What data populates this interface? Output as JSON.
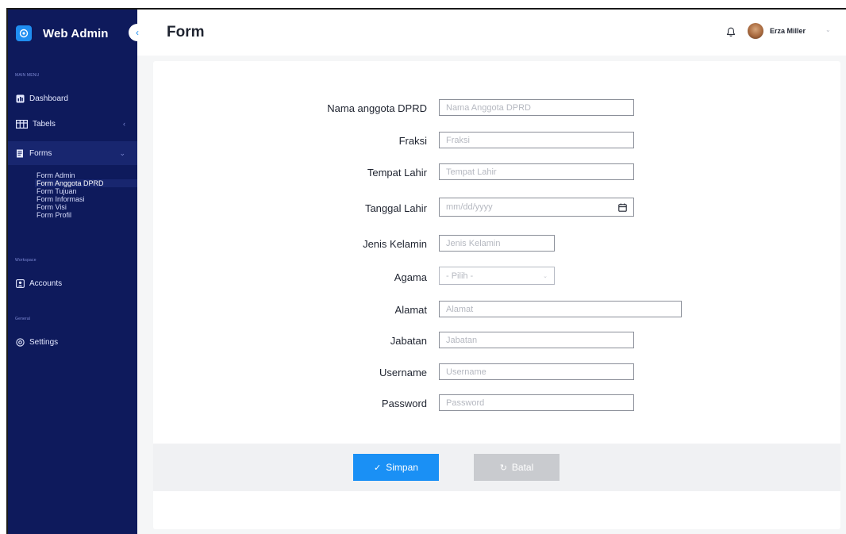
{
  "sidebar": {
    "brand": "Web Admin",
    "sections": {
      "main_menu": "MAIN MENU",
      "workspace": "Workspace",
      "general": "General"
    },
    "items": [
      {
        "label": "Dashboard",
        "icon": "dashboard-icon"
      },
      {
        "label": "Tabels",
        "icon": "table-icon"
      },
      {
        "label": "Forms",
        "icon": "forms-icon"
      },
      {
        "label": "Accounts",
        "icon": "accounts-icon"
      },
      {
        "label": "Settings",
        "icon": "settings-icon"
      }
    ],
    "form_sub_items": [
      "Form Admin",
      "Form Anggota DPRD",
      "Form Tujuan",
      "Form Informasi",
      "Form Visi",
      "Form Profil"
    ],
    "active_sub_item": "Form Anggota DPRD"
  },
  "header": {
    "title": "Form",
    "user_name": "Erza Miller"
  },
  "form": {
    "fields": [
      {
        "label": "Nama anggota DPRD",
        "placeholder": "Nama Anggota DPRD"
      },
      {
        "label": "Fraksi",
        "placeholder": "Fraksi"
      },
      {
        "label": "Tempat Lahir",
        "placeholder": "Tempat Lahir"
      },
      {
        "label": "Tanggal Lahir",
        "placeholder": "mm/dd/yyyy"
      },
      {
        "label": "Jenis Kelamin",
        "placeholder": "Jenis Kelamin"
      },
      {
        "label": "Agama",
        "placeholder": "- Pilih -"
      },
      {
        "label": "Alamat",
        "placeholder": "Alamat"
      },
      {
        "label": "Jabatan",
        "placeholder": "Jabatan"
      },
      {
        "label": "Username",
        "placeholder": "Username"
      },
      {
        "label": "Password",
        "placeholder": "Password"
      }
    ],
    "save_label": "Simpan",
    "cancel_label": "Batal"
  },
  "colors": {
    "sidebar_bg": "#0e1a5c",
    "accent": "#1a90f5",
    "cancel_button": "#c9cbcf"
  }
}
